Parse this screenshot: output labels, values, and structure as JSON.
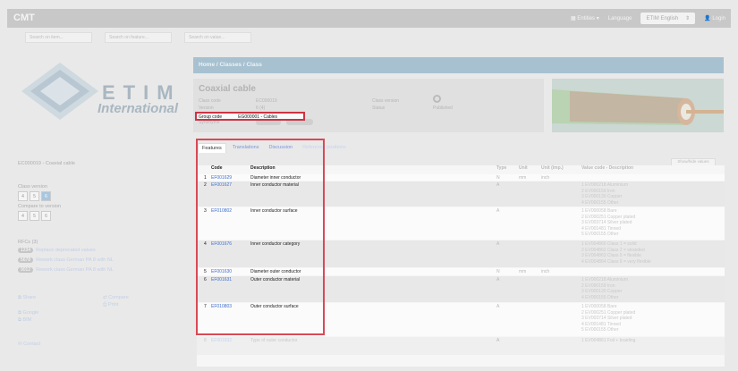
{
  "nav": {
    "brand": "CMT",
    "entities": "Entities",
    "language_label": "Language",
    "language_value": "ETIM English",
    "login": "Login"
  },
  "search": {
    "item": "Search on item...",
    "feature": "Search on feature...",
    "value": "Search on value..."
  },
  "logo": {
    "etim": "ETIM",
    "international": "International"
  },
  "sidebar": {
    "class_title": "EC000019 - Coaxial cable",
    "class_version_label": "Class version",
    "versions": [
      "4",
      "5",
      "6"
    ],
    "compare_label": "Compare to version",
    "compare_versions": [
      "4",
      "5",
      "6"
    ],
    "rfcs_label": "RFCs (3)",
    "rfcs": [
      {
        "tag": "1234",
        "text": "Replace deprecated values"
      },
      {
        "tag": "5678",
        "text": "Rework class German PA 8 with NL"
      },
      {
        "tag": "9012",
        "text": "Rework class German PA 8 with NL"
      }
    ],
    "share": "Share",
    "compare": "Compare",
    "print": "Print",
    "google": "Google",
    "bim": "BIM",
    "contact": "Contact"
  },
  "breadcrumb": "Home / Classes / Class",
  "class_info": {
    "title": "Coaxial cable",
    "class_code_label": "Class code",
    "class_code": "EC000019",
    "version_label": "Version",
    "version": "6 (4)",
    "class_version_label": "Class version",
    "status_label": "Status",
    "status": "Published",
    "group_code_label": "Group code",
    "group_code": "EG000001 - Cables",
    "synonyms_label": "Synonyms"
  },
  "tabs": [
    "Features",
    "Translations",
    "Discussion",
    "Reference positions"
  ],
  "show_hide": "Show/hide values",
  "table": {
    "headers": [
      "Code",
      "Description",
      "Type",
      "Unit",
      "Unit (imp.)",
      "Value code - Description"
    ],
    "rows": [
      {
        "num": "1",
        "code": "EF001629",
        "desc": "Diameter inner conductor",
        "type": "N",
        "unit": "mm",
        "imp": "inch",
        "values": []
      },
      {
        "num": "2",
        "code": "EF001627",
        "desc": "Inner conductor material",
        "type": "A",
        "unit": "",
        "imp": "",
        "values": [
          "1 EV000218 Aluminium",
          "2 EV000159 Iron",
          "3 EV000130 Copper",
          "4 EV000155 Other"
        ]
      },
      {
        "num": "3",
        "code": "EF010802",
        "desc": "Inner conductor surface",
        "type": "A",
        "unit": "",
        "imp": "",
        "values": [
          "1 EV000058 Bare",
          "2 EV000251 Copper plated",
          "3 EV003714 Silver plated",
          "4 EV001481 Tinned",
          "5 EV000155 Other"
        ]
      },
      {
        "num": "4",
        "code": "EF001676",
        "desc": "Inner conductor category",
        "type": "A",
        "unit": "",
        "imp": "",
        "values": [
          "1 EV004860 Class 1 = solid",
          "2 EV004862 Class 2 = stranded",
          "3 EV004863 Class 5 = flexible",
          "4 EV004864 Class 6 = very flexible"
        ]
      },
      {
        "num": "5",
        "code": "EF001630",
        "desc": "Diameter outer conductor",
        "type": "N",
        "unit": "mm",
        "imp": "inch",
        "values": []
      },
      {
        "num": "6",
        "code": "EF001631",
        "desc": "Outer conductor material",
        "type": "A",
        "unit": "",
        "imp": "",
        "values": [
          "1 EV000218 Aluminium",
          "2 EV000159 Iron",
          "3 EV000130 Copper",
          "4 EV000155 Other"
        ]
      },
      {
        "num": "7",
        "code": "EF010803",
        "desc": "Outer conductor surface",
        "type": "A",
        "unit": "",
        "imp": "",
        "values": [
          "1 EV000058 Bare",
          "2 EV000251 Copper plated",
          "3 EV003714 Silver plated",
          "4 EV001481 Tinned",
          "5 EV000155 Other"
        ]
      },
      {
        "num": "8",
        "code": "EF001632",
        "desc": "Type of outer conductor",
        "type": "A",
        "unit": "",
        "imp": "",
        "values": [
          "1 EV004861 Foil + braiding"
        ]
      }
    ]
  }
}
